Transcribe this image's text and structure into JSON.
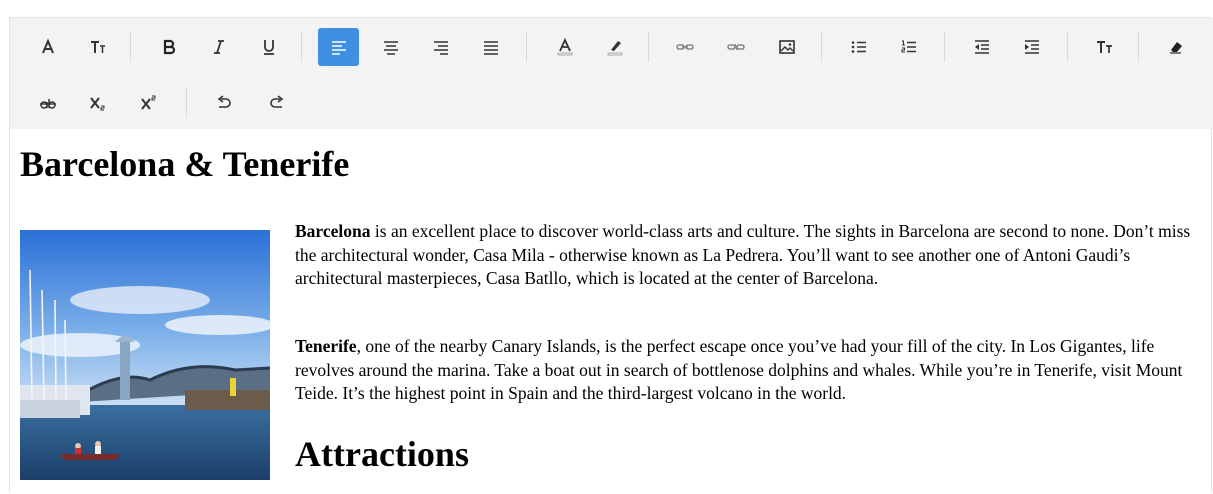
{
  "toolbar": {
    "icons": {
      "font_name": "font-name-icon",
      "font_size": "font-size-icon",
      "bold": "bold-icon",
      "italic": "italic-icon",
      "underline": "underline-icon",
      "align_left": "align-left-icon",
      "align_center": "align-center-icon",
      "align_right": "align-right-icon",
      "align_justify": "align-justify-icon",
      "font_color": "font-color-icon",
      "background_color": "highlight-icon",
      "create_link": "link-icon",
      "remove_link": "unlink-icon",
      "image": "image-icon",
      "unordered_list": "bulleted-list-icon",
      "ordered_list": "numbered-list-icon",
      "outdent": "outdent-icon",
      "indent": "indent-icon",
      "upper_lower_case": "text-case-icon",
      "clear_format": "eraser-icon",
      "strikethrough": "strikethrough-icon",
      "subscript": "subscript-icon",
      "superscript": "superscript-icon",
      "undo": "undo-icon",
      "redo": "redo-icon"
    },
    "active_color": "#3f8fe2"
  },
  "content": {
    "heading1": "Barcelona & Tenerife",
    "photo_alt": "Barcelona marina",
    "p1_bold": "Barcelona",
    "p1_text": " is an excellent place to discover world-class arts and culture. The sights in Barcelona are second to none. Don’t miss the architectural wonder, Casa Mila - otherwise known as La Pedrera. You’ll want to see another one of Antoni Gaudi’s architectural masterpieces, Casa Batllo, which is located at the center of Barcelona.",
    "p2_bold": "Tenerife",
    "p2_text": ", one of the nearby Canary Islands, is the perfect escape once you’ve had your fill of the city. In Los Gigantes, life revolves around the marina. Take a boat out in search of bottlenose dolphins and whales. While you’re in Tenerife, visit Mount Teide. It’s the highest point in Spain and the third-largest volcano in the world.",
    "heading2": "Attractions"
  }
}
